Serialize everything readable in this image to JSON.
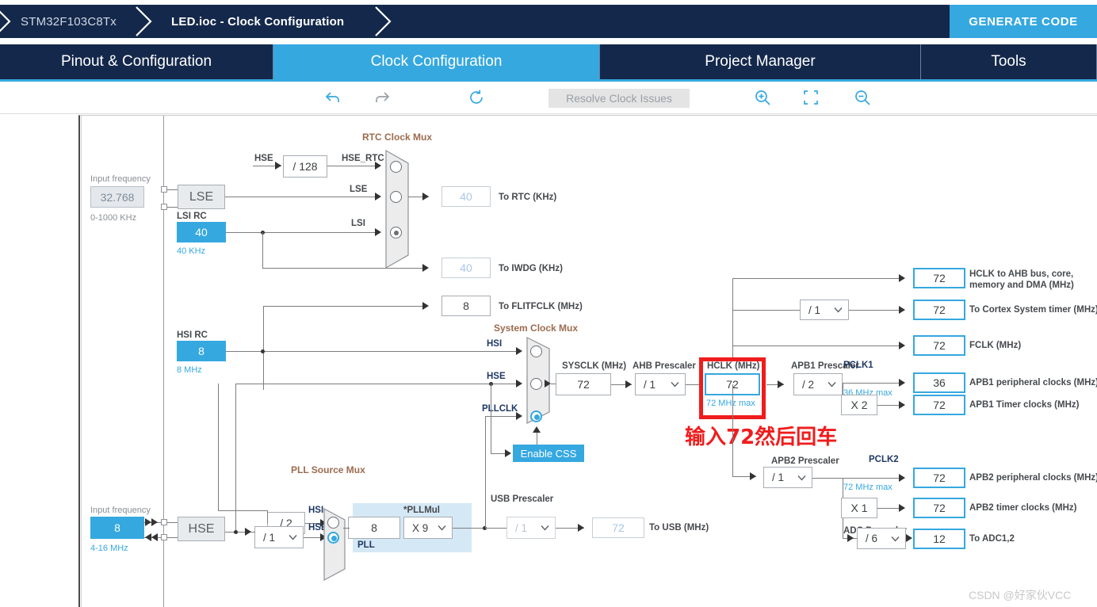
{
  "breadcrumb": {
    "device": "STM32F103C8Tx",
    "file": "LED.ioc - Clock Configuration",
    "generate_code": "GENERATE CODE"
  },
  "tabs": [
    {
      "label": "Pinout & Configuration",
      "selected": false
    },
    {
      "label": "Clock Configuration",
      "selected": true
    },
    {
      "label": "Project Manager",
      "selected": false
    },
    {
      "label": "Tools",
      "selected": false
    }
  ],
  "toolbar": {
    "undo": "undo-icon",
    "redo": "redo-icon",
    "reset": "reset-icon",
    "resolve_label": "Resolve Clock Issues",
    "zoom_in": "zoom-in-icon",
    "fit": "fit-to-screen-icon",
    "zoom_out": "zoom-out-icon"
  },
  "annotation": {
    "text": "输入72然后回车"
  },
  "watermark": {
    "text": "CSDN @好家伙VCC"
  },
  "colors": {
    "accent": "#35a8e0",
    "navy": "#14284b",
    "alert": "#f01c1c",
    "panel": "#d5e8f5"
  },
  "lse": {
    "input_frequency_label": "Input frequency",
    "value": "32.768",
    "range": "0-1000 KHz",
    "name": "LSE"
  },
  "lsi": {
    "title": "LSI RC",
    "value": "40",
    "unit": "40 KHz"
  },
  "hsi": {
    "title": "HSI RC",
    "value": "8",
    "unit": "8 MHz"
  },
  "hse": {
    "input_frequency_label": "Input frequency",
    "value": "8",
    "range": "4-16 MHz",
    "name": "HSE"
  },
  "rtc_mux": {
    "title": "RTC Clock Mux",
    "hse_label": "HSE",
    "hse_div": "/ 128",
    "hse_rtc_label": "HSE_RTC",
    "lse_label": "LSE",
    "lsi_label": "LSI",
    "selected": "LSI"
  },
  "outputs_left": [
    {
      "value": "40",
      "label": "To RTC (KHz)",
      "enabled": false
    },
    {
      "value": "40",
      "label": "To IWDG (KHz)",
      "enabled": false
    },
    {
      "value": "8",
      "label": "To FLITFCLK (MHz)",
      "enabled": true
    }
  ],
  "system_clock_mux": {
    "title": "System Clock Mux",
    "inputs": [
      "HSI",
      "HSE",
      "PLLCLK"
    ],
    "selected": "PLLCLK",
    "css_button": "Enable CSS"
  },
  "pll_source_mux": {
    "title": "PLL Source Mux",
    "hsi_div": "/ 2",
    "hsi_label": "HSI",
    "hse_label": "HSE",
    "hse_div": "/ 1",
    "selected": "HSE"
  },
  "pll": {
    "panel_label": "PLL",
    "mul_label": "*PLLMul",
    "input_value": "8",
    "mul_value": "X 9"
  },
  "usb": {
    "prescaler_label": "USB Prescaler",
    "prescaler_value": "/ 1",
    "output_value": "72",
    "output_label": "To USB (MHz)"
  },
  "sysclk": {
    "label": "SYSCLK (MHz)",
    "value": "72"
  },
  "ahb_prescaler": {
    "label": "AHB Prescaler",
    "value": "/ 1"
  },
  "hclk": {
    "label": "HCLK (MHz)",
    "value": "72",
    "max": "72 MHz max",
    "highlighted": true
  },
  "ahb_outputs": [
    {
      "value": "72",
      "label": "HCLK to AHB bus, core, memory and DMA (MHz)"
    },
    {
      "value": "72",
      "label": "To Cortex System timer (MHz)",
      "prescaler": "/ 1"
    },
    {
      "value": "72",
      "label": "FCLK (MHz)"
    }
  ],
  "apb1": {
    "prescaler_label": "APB1 Prescaler",
    "prescaler_value": "/ 2",
    "pclk_label": "PCLK1",
    "max": "36 MHz max",
    "timer_mul": "X 2",
    "peripheral": {
      "value": "36",
      "label": "APB1 peripheral clocks (MHz)"
    },
    "timer": {
      "value": "72",
      "label": "APB1 Timer clocks (MHz)"
    }
  },
  "apb2": {
    "prescaler_label": "APB2 Prescaler",
    "prescaler_value": "/ 1",
    "pclk_label": "PCLK2",
    "max": "72 MHz max",
    "timer_mul": "X 1",
    "peripheral": {
      "value": "72",
      "label": "APB2 peripheral clocks (MHz)"
    },
    "timer": {
      "value": "72",
      "label": "APB2 timer clocks (MHz)"
    },
    "adc_prescaler_label": "ADC Prescaler",
    "adc_prescaler_value": "/ 6",
    "adc": {
      "value": "12",
      "label": "To ADC1,2"
    }
  }
}
